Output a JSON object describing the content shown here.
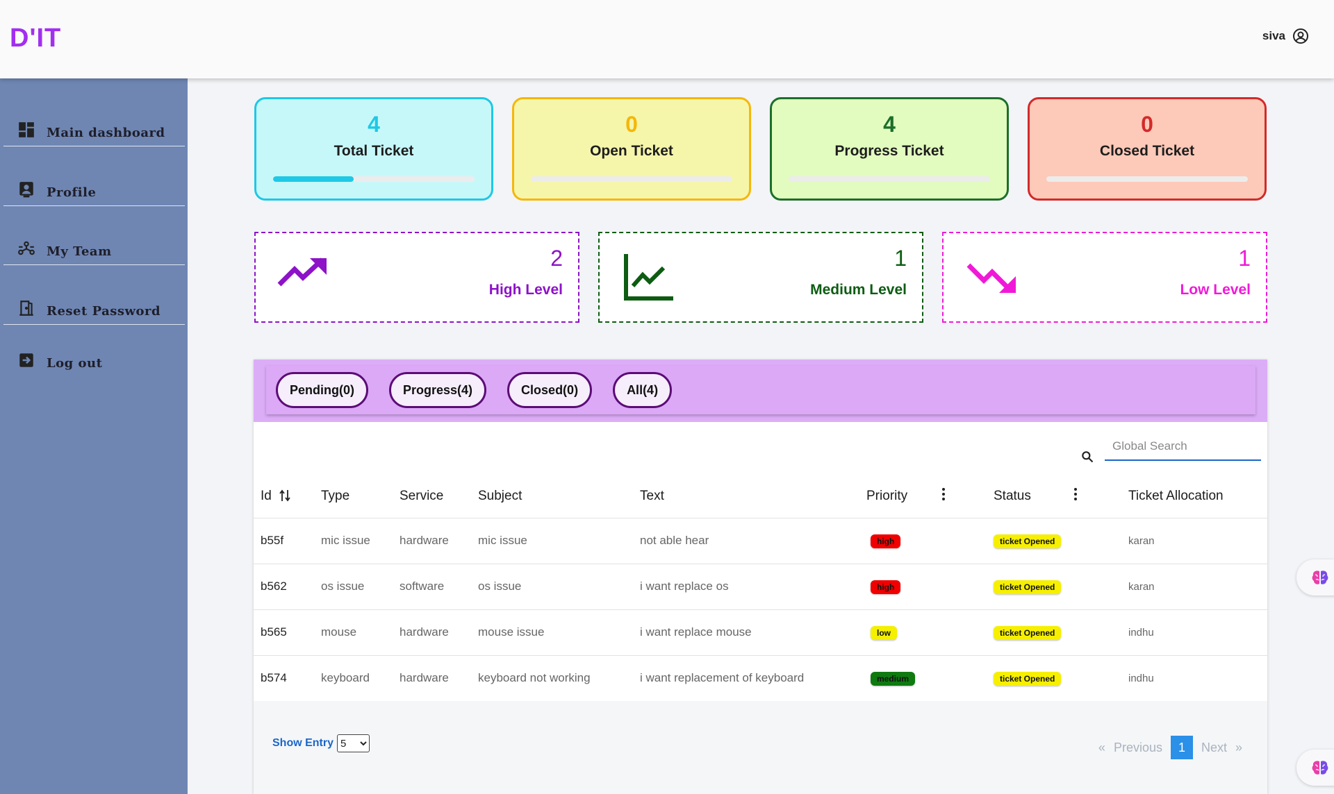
{
  "app": {
    "logo": "D'IT",
    "user": "siva"
  },
  "sidebar": {
    "items": [
      {
        "label": "Main  dashboard",
        "icon": "dashboard-icon"
      },
      {
        "label": "Profile",
        "icon": "profile-icon"
      },
      {
        "label": "My  Team",
        "icon": "team-icon"
      },
      {
        "label": "Reset  Password",
        "icon": "door-icon"
      },
      {
        "label": "Log  out",
        "icon": "logout-icon"
      }
    ]
  },
  "cards": [
    {
      "value": "4",
      "label": "Total Ticket",
      "progress": 0.4,
      "color": "#1ec8e6",
      "bg": "#c7f8f9",
      "fill": "#1ec8e6"
    },
    {
      "value": "0",
      "label": "Open Ticket",
      "progress": 0,
      "color": "#f5b70a",
      "bg": "#f6f6ab",
      "fill": "#f5b70a"
    },
    {
      "value": "4",
      "label": "Progress Ticket",
      "progress": 0,
      "color": "#1b6f2a",
      "bg": "#e2fbbf",
      "fill": "#1b6f2a"
    },
    {
      "value": "0",
      "label": "Closed Ticket",
      "progress": 0,
      "color": "#d22a2a",
      "bg": "#fdc9b8",
      "fill": "#d22a2a"
    }
  ],
  "levels": [
    {
      "value": "2",
      "label": "High Level",
      "color": "#8d12c8",
      "icon": "trending-up-icon"
    },
    {
      "value": "1",
      "label": "Medium Level",
      "color": "#0d5c12",
      "icon": "line-chart-icon"
    },
    {
      "value": "1",
      "label": "Low Level",
      "color": "#f019d8",
      "icon": "trending-down-icon"
    }
  ],
  "tabs": [
    "Pending(0)",
    "Progress(4)",
    "Closed(0)",
    "All(4)"
  ],
  "search": {
    "placeholder": "Global Search"
  },
  "table": {
    "columns": [
      "Id",
      "Type",
      "Service",
      "Subject",
      "Text",
      "Priority",
      "Status",
      "Ticket Allocation"
    ],
    "rows": [
      {
        "id": "b55f",
        "type": "mic issue",
        "service": "hardware",
        "subject": "mic issue",
        "text": "not able hear",
        "priority": "high",
        "status": "ticket Opened",
        "allocation": "karan"
      },
      {
        "id": "b562",
        "type": "os issue",
        "service": "software",
        "subject": "os issue",
        "text": "i want replace os",
        "priority": "high",
        "status": "ticket Opened",
        "allocation": "karan"
      },
      {
        "id": "b565",
        "type": "mouse",
        "service": "hardware",
        "subject": "mouse issue",
        "text": "i want replace mouse",
        "priority": "low",
        "status": "ticket Opened",
        "allocation": "indhu"
      },
      {
        "id": "b574",
        "type": "keyboard",
        "service": "hardware",
        "subject": "keyboard not working",
        "text": "i want replacement of keyboard",
        "priority": "medium",
        "status": "ticket Opened",
        "allocation": "indhu"
      }
    ]
  },
  "priority_colors": {
    "high": "#f00000",
    "low": "#f4f000",
    "medium": "#0e7a10"
  },
  "status_color": "#f6f000",
  "footer": {
    "show_entry_label": "Show Entry",
    "entry_value": "5",
    "pagination": {
      "first": "«",
      "previous": "Previous",
      "current": "1",
      "next": "Next",
      "last": "»"
    }
  }
}
